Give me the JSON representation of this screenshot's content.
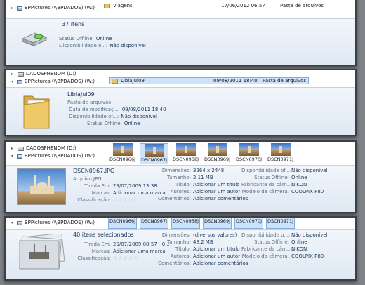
{
  "panel1": {
    "nav": [
      "BPPictures (\\\\BPDADOS) (W:)"
    ],
    "file": {
      "name": "Viagens",
      "date": "17/06/2012 06:57",
      "type": "Pasta de arquivos"
    },
    "count": "37 itens",
    "status_label": "Status Offline:",
    "status_value": "Online",
    "avail_label": "Disponibilidade o...:",
    "avail_value": "Não disponível"
  },
  "panel2": {
    "nav": [
      "DADOSPHENOM (D:)",
      "BPPictures (\\\\BPDADOS) (W:)"
    ],
    "file": {
      "name": "LibiaJul09",
      "date": "09/08/2011 18:40",
      "type": "Pasta de arquivos"
    },
    "title": "LibiaJul09",
    "subtitle": "Pasta de arquivos",
    "rows": [
      {
        "label": "Data de modificaç...:",
        "value": "09/08/2011 18:40"
      },
      {
        "label": "Disponibilidade of...:",
        "value": "Não disponível"
      },
      {
        "label": "Status Offline:",
        "value": "Online"
      }
    ]
  },
  "panel3": {
    "nav": [
      "DADOSPHENOM (D:)",
      "BPPictures (\\\\BPDADOS) (W:)"
    ],
    "thumbs": [
      "DSCN0966J",
      "DSCN0967J",
      "DSCN0968J",
      "DSCN0969J",
      "DSCN0970J",
      "DSCN0971J"
    ],
    "title": "DSCN0967.JPG",
    "subtitle": "Arquivo JPG",
    "col1": [
      {
        "label": "Tirada Em:",
        "value": "29/07/2009 13:38"
      },
      {
        "label": "Marcas:",
        "value": "Adicionar uma marca"
      },
      {
        "label": "Classificação:",
        "value": "☆☆☆☆☆"
      }
    ],
    "col2": [
      {
        "label": "Dimensões:",
        "value": "3264 x 2448"
      },
      {
        "label": "Tamanho:",
        "value": "2,11 MB"
      },
      {
        "label": "Título:",
        "value": "Adicionar um título"
      },
      {
        "label": "Autores:",
        "value": "Adicionar um autor"
      },
      {
        "label": "Comentários:",
        "value": "Adicionar comentários"
      }
    ],
    "col3": [
      {
        "label": "Disponibilidade of...:",
        "value": "Não disponível"
      },
      {
        "label": "Status Offline:",
        "value": "Online"
      },
      {
        "label": "Fabricante da câm...:",
        "value": "NIKON"
      },
      {
        "label": "Modelo da câmera:",
        "value": "COOLPIX P80"
      }
    ]
  },
  "panel4": {
    "nav": [
      "BPPictures (\\\\BPDADOS) (W:)"
    ],
    "thumbs": [
      "DSCN0966J",
      "DSCN0967J",
      "DSCN0968J",
      "DSCN0969J",
      "DSCN0970J",
      "DSCN0971J"
    ],
    "title": "40 itens selecionados",
    "col1": [
      {
        "label": "Tirada Em:",
        "value": "29/07/2009 08:57 - 0..."
      },
      {
        "label": "Marcas:",
        "value": "Adicionar uma marca"
      },
      {
        "label": "Classificação:",
        "value": "☆☆☆☆☆"
      }
    ],
    "col2": [
      {
        "label": "Dimensões:",
        "value": "(diversos valores)"
      },
      {
        "label": "Tamanho:",
        "value": "48,2 MB"
      },
      {
        "label": "Título:",
        "value": "Adicionar um título"
      },
      {
        "label": "Autores:",
        "value": "Adicionar um autor"
      },
      {
        "label": "Comentários:",
        "value": "Adicionar comentários"
      }
    ],
    "col3": [
      {
        "label": "Disponibilidade o...:",
        "value": "Não disponível"
      },
      {
        "label": "Status Offline:",
        "value": "Online"
      },
      {
        "label": "Fabricante da câm...:",
        "value": "NIKON"
      },
      {
        "label": "Modelo da câmera:",
        "value": "COOLPIX P80"
      }
    ]
  }
}
